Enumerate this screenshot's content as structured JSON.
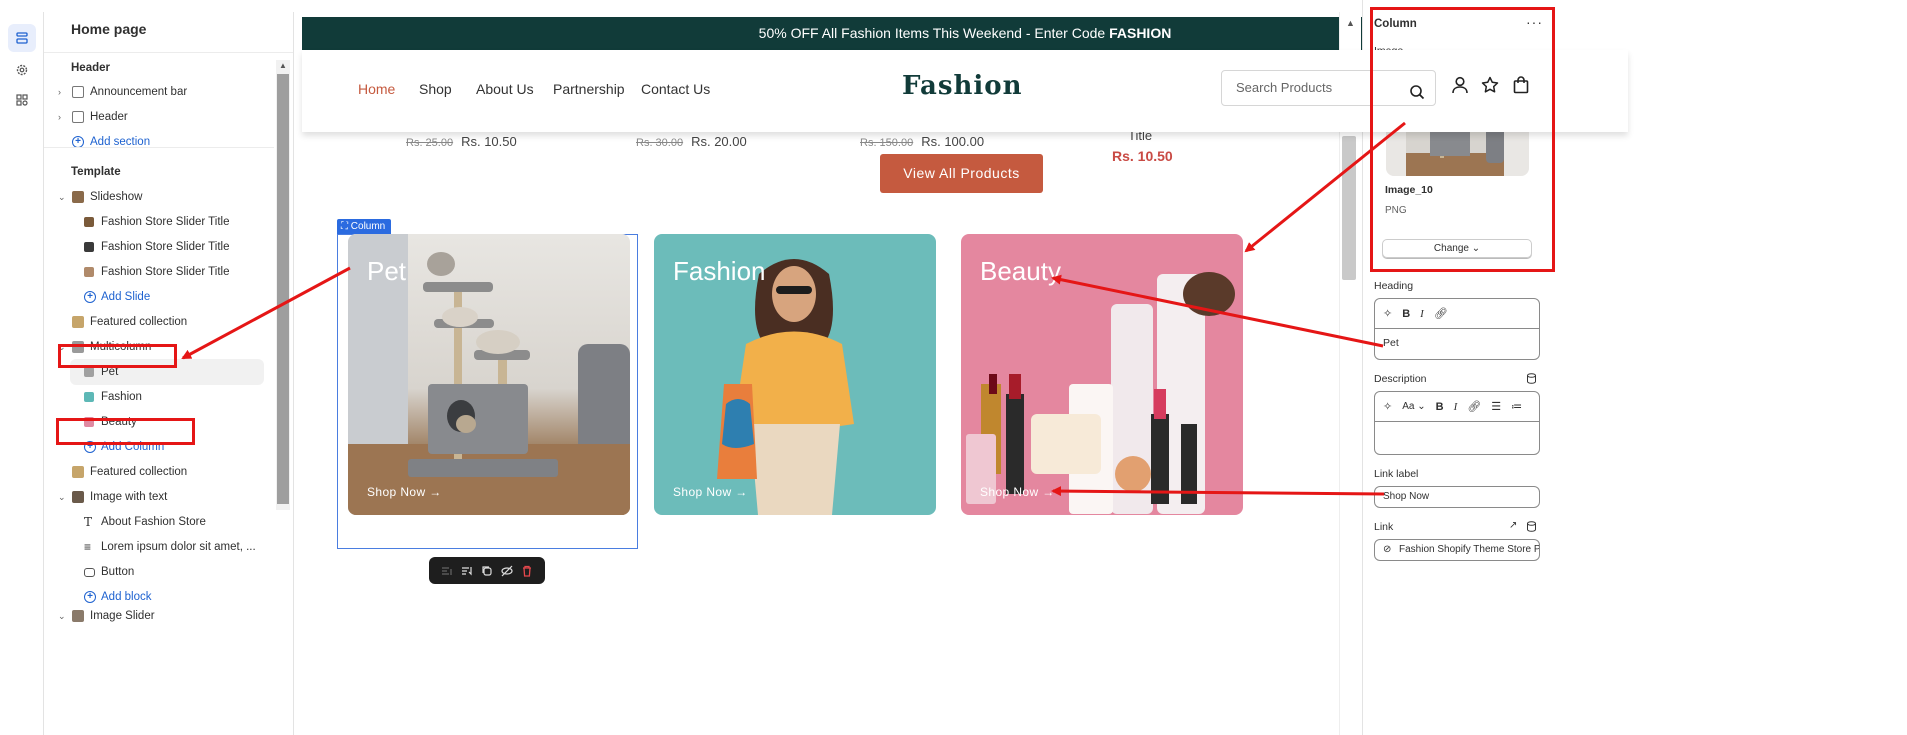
{
  "left_panel": {
    "title": "Home page",
    "header_group": "Header",
    "announcement_bar": "Announcement bar",
    "header_item": "Header",
    "add_section": "Add section",
    "template_group": "Template",
    "slideshow": "Slideshow",
    "slides": [
      "Fashion Store Slider Title",
      "Fashion Store Slider Title",
      "Fashion Store Slider Title"
    ],
    "add_slide": "Add Slide",
    "featured_collection": "Featured collection",
    "multicolumn": "Multicolumn",
    "columns": [
      "Pet",
      "Fashion",
      "Beauty"
    ],
    "add_column": "Add Column",
    "featured_collection_2": "Featured collection",
    "image_with_text": "Image with text",
    "iwt_blocks": [
      "About Fashion Store",
      "Lorem ipsum dolor sit amet, ...",
      "Button"
    ],
    "add_block": "Add block",
    "image_slider": "Image Slider"
  },
  "store": {
    "announcement": "50% OFF All Fashion Items This Weekend - Enter Code ",
    "announcement_code": "FASHION",
    "nav": [
      "Home",
      "Shop",
      "About Us",
      "Partnership",
      "Contact Us"
    ],
    "logo": "Fashion",
    "search_placeholder": "Search Products",
    "prices": [
      {
        "old": "Rs. 25.00",
        "new": "Rs. 10.50"
      },
      {
        "old": "Rs. 30.00",
        "new": "Rs. 20.00"
      },
      {
        "old": "Rs. 150.00",
        "new": "Rs. 100.00"
      }
    ],
    "fourth_title": "Title",
    "fourth_price": "Rs. 10.50",
    "view_all": "View All Products",
    "column_tag": "Column",
    "cards": [
      {
        "heading": "Pet",
        "link": "Shop Now →"
      },
      {
        "heading": "Fashion",
        "link": "Shop Now →"
      },
      {
        "heading": "Beauty",
        "link": "Shop Now →"
      }
    ]
  },
  "right_panel": {
    "title": "Column",
    "more": "···",
    "image_label": "Image",
    "image_name": "Image_10",
    "image_type": "PNG",
    "change_label": "Change ⌄",
    "heading_label": "Heading",
    "heading_value": "Pet",
    "description_label": "Description",
    "font_size": "Aa",
    "link_label_label": "Link label",
    "link_label_value": "Shop Now",
    "link_label": "Link",
    "link_value": "Fashion Shopify Theme Store P"
  },
  "colors": {
    "announce_bg": "#113b39",
    "accent": "#c55a3f",
    "annotation": "#e51616",
    "selection": "#2b6be0"
  }
}
